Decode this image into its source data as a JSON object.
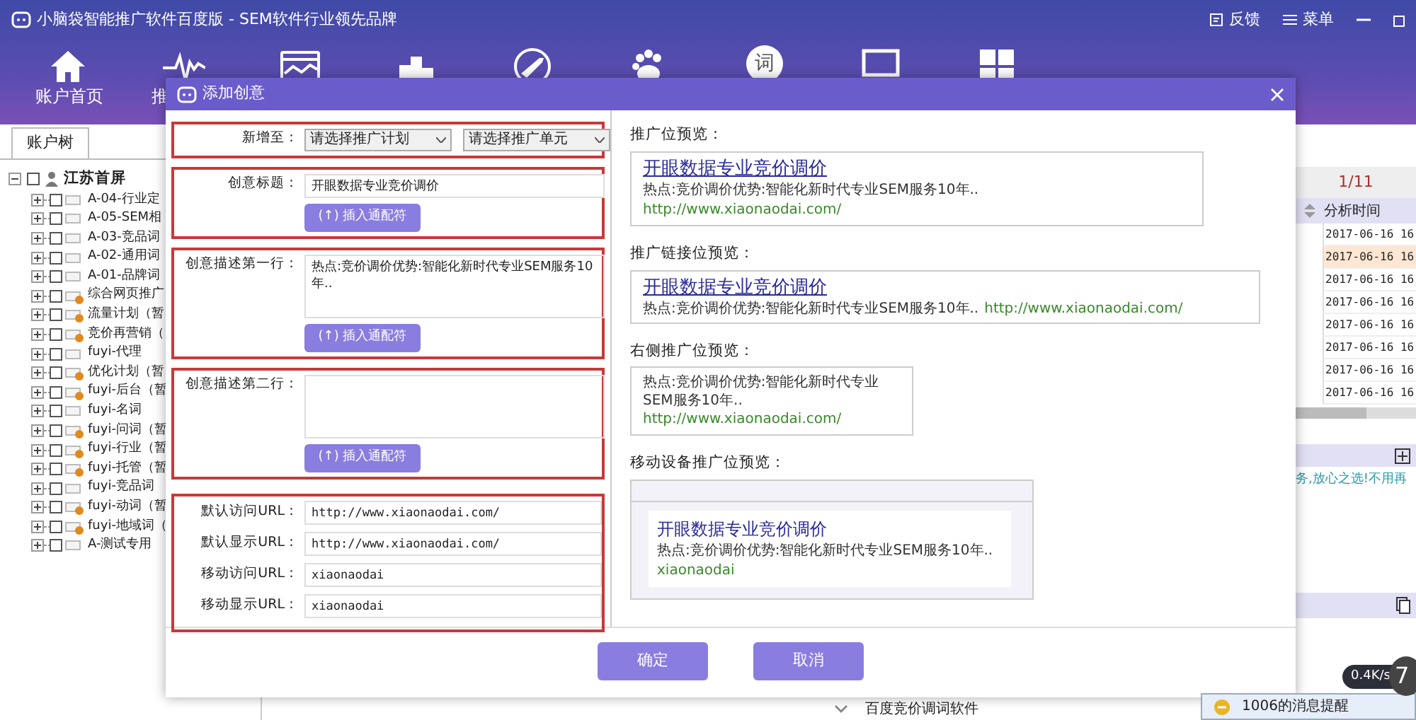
{
  "window": {
    "title": "小脑袋智能推广软件百度版 - SEM软件行业领先品牌",
    "actions": [
      {
        "label": "反馈"
      },
      {
        "label": "菜单"
      }
    ]
  },
  "nav": {
    "labels": [
      "账户首页",
      "推"
    ],
    "search_glyph": "词"
  },
  "sidebar": {
    "tab": "账户树",
    "tree": {
      "label": "江苏首屏",
      "checked": false,
      "expanded": true,
      "children": [
        {
          "label": "A-04-行业定",
          "checked": false,
          "expanded": false,
          "paused": false
        },
        {
          "label": "A-05-SEM相",
          "checked": false,
          "expanded": false,
          "paused": false
        },
        {
          "label": "A-03-竞品词",
          "checked": false,
          "expanded": false,
          "paused": false
        },
        {
          "label": "A-02-通用词",
          "checked": false,
          "expanded": false,
          "paused": false
        },
        {
          "label": "A-01-品牌词",
          "checked": false,
          "expanded": false,
          "paused": false
        },
        {
          "label": "综合网页推广",
          "checked": false,
          "expanded": false,
          "paused": true
        },
        {
          "label": "流量计划（暂",
          "checked": false,
          "expanded": false,
          "paused": true
        },
        {
          "label": "竞价再营销（",
          "checked": false,
          "expanded": false,
          "paused": true
        },
        {
          "label": "fuyi-代理",
          "checked": false,
          "expanded": false,
          "paused": false
        },
        {
          "label": "优化计划（暂",
          "checked": false,
          "expanded": false,
          "paused": true
        },
        {
          "label": "fuyi-后台（暂",
          "checked": false,
          "expanded": false,
          "paused": true
        },
        {
          "label": "fuyi-名词",
          "checked": false,
          "expanded": false,
          "paused": false
        },
        {
          "label": "fuyi-问词（暂",
          "checked": false,
          "expanded": false,
          "paused": true
        },
        {
          "label": "fuyi-行业（暂",
          "checked": false,
          "expanded": false,
          "paused": true
        },
        {
          "label": "fuyi-托管（暂",
          "checked": false,
          "expanded": false,
          "paused": true
        },
        {
          "label": "fuyi-竞品词",
          "checked": false,
          "expanded": false,
          "paused": false
        },
        {
          "label": "fuyi-动词（暂",
          "checked": false,
          "expanded": false,
          "paused": true
        },
        {
          "label": "fuyi-地域词（",
          "checked": false,
          "expanded": false,
          "paused": true
        },
        {
          "label": "A-测试专用",
          "checked": false,
          "expanded": false,
          "paused": false
        }
      ]
    }
  },
  "background_panel": {
    "pager": "1/11",
    "column": "分析时间",
    "rows": [
      {
        "value": "2017-06-16 16",
        "selected": false
      },
      {
        "value": "2017-06-16 16",
        "selected": true
      },
      {
        "value": "2017-06-16 16",
        "selected": false
      },
      {
        "value": "2017-06-16 16",
        "selected": false
      },
      {
        "value": "2017-06-16 16",
        "selected": false
      },
      {
        "value": "2017-06-16 16",
        "selected": false
      },
      {
        "value": "2017-06-16 16",
        "selected": false
      },
      {
        "value": "2017-06-16 16",
        "selected": false
      }
    ],
    "snippet": "务,放心之选!不用再",
    "bottom_text": "百度竞价调词软件"
  },
  "notification": {
    "text": "1006的消息提醒"
  },
  "speed_widget": {
    "reading": "0.4K/s",
    "badge": "7"
  },
  "dialog": {
    "title": "添加创意",
    "form": [
      {
        "kind": "selects",
        "label": "新增至：",
        "highlighted": true,
        "options": [
          "请选择推广计划",
          "请选择推广单元"
        ]
      },
      {
        "kind": "input",
        "label": "创意标题：",
        "value": "开眼数据专业竞价调价",
        "button": "(↑) 插入通配符",
        "highlighted": true
      },
      {
        "kind": "textarea",
        "label": "创意描述第一行：",
        "value": "热点:竞价调价优势:智能化新时代专业SEM服务10年..",
        "button": "(↑) 插入通配符",
        "highlighted": true
      },
      {
        "kind": "textarea",
        "label": "创意描述第二行：",
        "button": "(↑) 插入通配符",
        "highlighted": true
      }
    ],
    "urls": {
      "highlighted": true,
      "fields": [
        {
          "label": "默认访问URL：",
          "value": "http://www.xiaonaodai.com/"
        },
        {
          "label": "默认显示URL：",
          "value": "http://www.xiaonaodai.com/"
        },
        {
          "label": "移动访问URL：",
          "value": "xiaonaodai"
        },
        {
          "label": "移动显示URL：",
          "value": "xiaonaodai"
        }
      ]
    },
    "previews": [
      {
        "kind": "standard",
        "label": "推广位预览：",
        "title": "开眼数据专业竞价调价",
        "description": "热点:竞价调价优势:智能化新时代专业SEM服务10年..",
        "url": "http://www.xiaonaodai.com/"
      },
      {
        "kind": "link",
        "label": "推广链接位预览：",
        "title": "开眼数据专业竞价调价",
        "description": "热点:竞价调价优势:智能化新时代专业SEM服务10年..",
        "url": "http://www.xiaonaodai.com/"
      },
      {
        "kind": "side",
        "label": "右侧推广位预览：",
        "description": "热点:竞价调价优势:智能化新时代专业SEM服务10年..",
        "url": "http://www.xiaonaodai.com/"
      },
      {
        "kind": "mobile",
        "label": "移动设备推广位预览：",
        "title": "开眼数据专业竞价调价",
        "description": "热点:竞价调价优势:智能化新时代专业SEM服务10年..",
        "url": "xiaonaodai"
      }
    ],
    "buttons": [
      {
        "label": "确定"
      },
      {
        "label": "取消"
      }
    ]
  }
}
